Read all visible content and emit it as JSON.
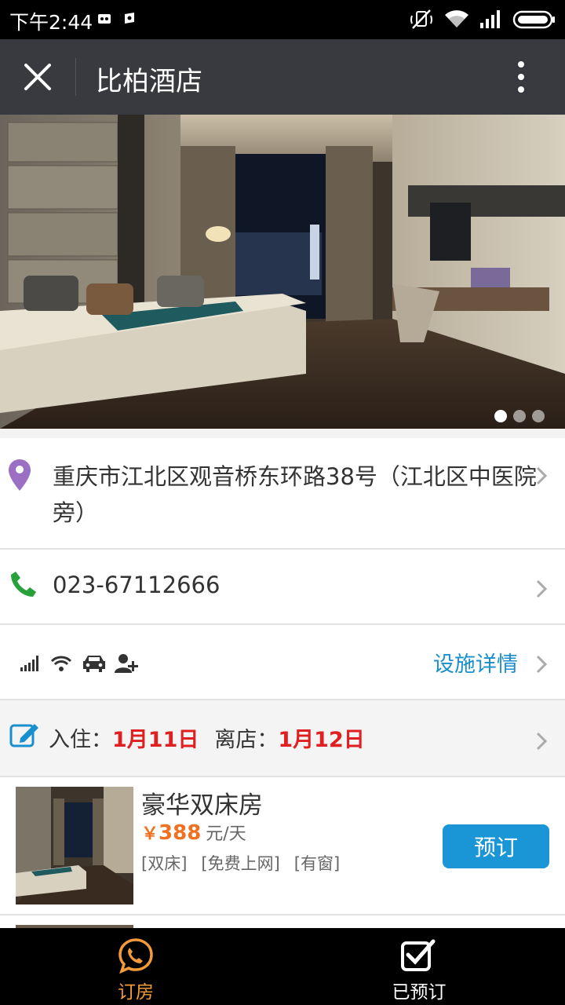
{
  "status_bar": {
    "time": "下午2:44",
    "icons": [
      "notification-icon",
      "notification-icon",
      "mute-icon",
      "wifi-icon",
      "signal-icon",
      "battery-icon"
    ]
  },
  "title_bar": {
    "title": "比柏酒店",
    "close_icon": "close-icon",
    "more_icon": "more-vertical-icon"
  },
  "hero": {
    "slides_total": 3,
    "active_slide": 1
  },
  "address": {
    "text": "重庆市江北区观音桥东环路38号（江北区中医院旁）"
  },
  "phone": {
    "number": "023-67112666"
  },
  "facilities": {
    "icons": [
      "signal-icon",
      "wifi-icon",
      "parking-car-icon",
      "add-user-icon"
    ],
    "link_label": "设施详情"
  },
  "stay": {
    "checkin_label": "入住：",
    "checkin_date": "1月11日",
    "checkout_label": "离店：",
    "checkout_date": "1月12日"
  },
  "rooms": [
    {
      "name": "豪华双床房",
      "currency": "￥",
      "price": "388",
      "unit": "元/天",
      "tags": [
        "[双床]",
        "[免费上网]",
        "[有窗]"
      ],
      "book_label": "预订"
    }
  ],
  "bottom_nav": {
    "items": [
      {
        "label": "订房",
        "icon": "chat-phone-icon",
        "active": true
      },
      {
        "label": "已预订",
        "icon": "checkbox-icon",
        "active": false
      }
    ]
  },
  "colors": {
    "title_bar": "#393a3f",
    "accent_blue": "#1a95d6",
    "price_orange": "#f07020",
    "date_red": "#e02020",
    "nav_active": "#f29b38"
  }
}
